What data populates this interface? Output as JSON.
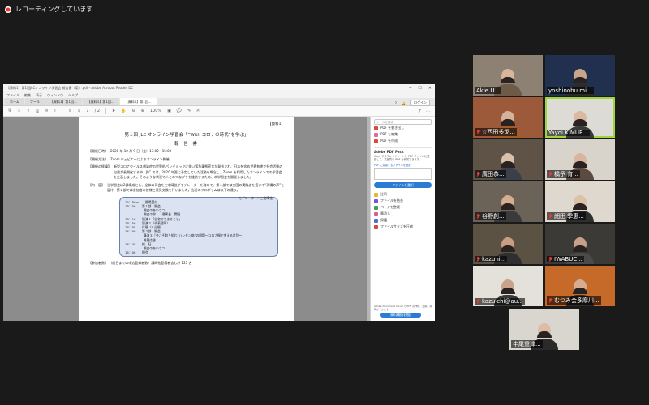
{
  "recording": {
    "label": "レコーディングしています"
  },
  "acrobat": {
    "titlebar_text": "【資料1】第1回JLCオンライン学習会 報告書（案）.pdf - Adobe Acrobat Reader DC",
    "menu": [
      "ファイル",
      "編集",
      "表示",
      "ウィンドウ",
      "ヘルプ"
    ],
    "tabs": [
      {
        "label": "ホーム"
      },
      {
        "label": "ツール"
      },
      {
        "label": "【資料1】第1回..."
      },
      {
        "label": "【資料1】第1回..."
      },
      {
        "label": "【資料1】第1回..."
      }
    ],
    "login_label": "ログイン",
    "toolbar": {
      "page_current": "1",
      "page_total": "/ 2",
      "zoom": "100%"
    },
    "document": {
      "annotation": "【資料1】",
      "title": "第１回 JLC オンライン学習会「“With コロナの時代”を学ぶ」",
      "subtitle": "報 告 書",
      "fields": [
        {
          "label": "【開催日時】",
          "value": "2020 年 10 月 9 日（金）13:00～15:00"
        },
        {
          "label": "【開催方法】",
          "value": "Zoom ウェビナーによるオンライン開催"
        },
        {
          "label": "【開催の経緯】",
          "value": "新型コロナウイルス感染症の世界的パンデミックに伴い緊急事態宣言が発出され、日本を含め世界各地で社会活動の自粛が長期化する中、JLC では、2020 年夏に予定していた活動を断念し、Zoom を利用したオンラインでの学習会を企画しました。そのような状況で人とのつながりを維持するため、本学習会を開催しました。"
        },
        {
          "label": "【内　容】",
          "value": "当学習会は2部構成とし、全体の司会を三宅晴佳がモデレーターを務めて、第１部では全国の実践者を招いて“現場の声”を届け、第２部では参加者の皆様と意見交換を行いました。当日のプログラムは以下の通り。"
        }
      ],
      "program": {
        "moderator": "モデレーター：三宅晴佳",
        "rows": [
          "12：50～　　開場受付",
          "13：00　　第１部　開会",
          "　　　　　　開会のあいさつ",
          "　　　　　　開会の辞　　理事長　関田",
          "13：10　　講演１「自宅でできること」",
          "13：50　　講演２（代表理事）",
          "13：55　　休憩（5 分間）",
          "14：00　　第２部　開会",
          "　　　　　　講演３『今こそ取り組む“ハンセン病”の問題～コロナ禍で考える差別～』",
          "　　　　　　質疑応答",
          "14：45　　総　括",
          "　　　　　　閉会のあいさつ",
          "15：00　　閉会"
        ]
      },
      "footer_label": "【参加者数】",
      "footer_value": "（前日までの申込登録者数）講師他登壇者含む計 123 名"
    },
    "sidebar": {
      "search_placeholder": "ツールを検索",
      "tools": [
        {
          "label": "PDF を書き出し",
          "color": "#e0473a"
        },
        {
          "label": "PDF を編集",
          "color": "#e06a9a"
        },
        {
          "label": "PDF を作成",
          "color": "#e0473a"
        }
      ],
      "pack_title": "Adobe PDF Pack",
      "pack_desc": "Word やスプレッドシートを PDF ファイルに変換して、高品質な PDF を作成できます。",
      "link": "PDF に変換するファイルを選択",
      "select_button": "ファイルを選択",
      "more_tools": [
        {
          "label": "注釈",
          "color": "#e8b72c"
        },
        {
          "label": "ファイルを結合",
          "color": "#7b55c9"
        },
        {
          "label": "ページを整理",
          "color": "#3aa35a"
        },
        {
          "label": "墨消し",
          "color": "#e05a8a"
        },
        {
          "label": "保護",
          "color": "#4a74c9"
        },
        {
          "label": "ファイルサイズを圧縮",
          "color": "#d9433a"
        }
      ],
      "bottom_text": "Adobe Document Cloud で PDF の作成、変換、共有ができます。",
      "free_trial_button": "無料体験版を開始"
    }
  },
  "participants": [
    {
      "name": "Akie U...",
      "muted": false,
      "bg": "#8c8173",
      "skin": "#d9b59c",
      "shirt": "#6d5a48"
    },
    {
      "name": "yoshinobu mi...",
      "muted": false,
      "bg": "#20304e",
      "skin": "#c9a58c",
      "shirt": "#2b2b2b"
    },
    {
      "name": "☆西田多戈...",
      "muted": true,
      "bg": "#9c5a3a",
      "skin": "#d6b29a",
      "shirt": "#a15c2c"
    },
    {
      "name": "Yayoi KIMUR...",
      "muted": false,
      "bg": "#dcdbd5",
      "skin": "#dbb9a0",
      "shirt": "#3a3a3a"
    },
    {
      "name": "廣田恭...",
      "muted": true,
      "bg": "#5e5346",
      "skin": "#dbc0aa",
      "shirt": "#3b3f4a"
    },
    {
      "name": "橋予 育...",
      "muted": true,
      "bg": "#d8d3cb",
      "skin": "#d8b59c",
      "shirt": "#5a4a3f"
    },
    {
      "name": "谷野創...",
      "muted": true,
      "bg": "#6b6357",
      "skin": "#d4ad92",
      "shirt": "#3a3a3a"
    },
    {
      "name": "細田 季恵...",
      "muted": true,
      "bg": "#ded8ce",
      "skin": "#dcc0a8",
      "shirt": "#2e2e2e"
    },
    {
      "name": "kazuhi...",
      "muted": true,
      "bg": "#5b5244",
      "skin": "#c99f84",
      "shirt": "#2f2f2f"
    },
    {
      "name": "IWABUC...",
      "muted": true,
      "bg": "#3c3a37",
      "skin": "#c7a08a",
      "shirt": "#4a4a4a"
    },
    {
      "name": "kazuichi@au...",
      "muted": true,
      "bg": "#e4e1da",
      "skin": "#c9a38a",
      "shirt": "#3a3a3a"
    },
    {
      "name": "むつみ会多摩川...",
      "muted": true,
      "bg": "#c66a2a",
      "skin": "#d4ad92",
      "shirt": "#2f2a25"
    },
    {
      "name": "牛尾重津...",
      "muted": false,
      "bg": "#d9d6cf",
      "skin": "#dcbca4",
      "shirt": "#2a2a2a"
    }
  ]
}
